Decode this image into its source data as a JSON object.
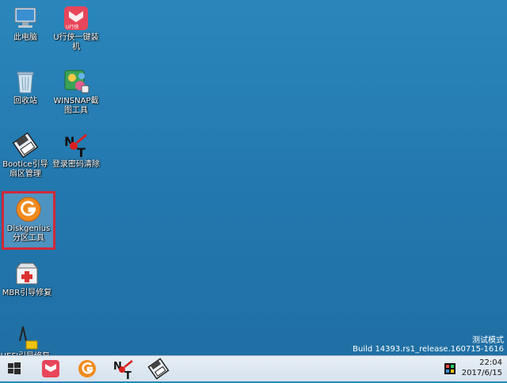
{
  "desktop": {
    "icons": [
      {
        "label": "此电脑",
        "icon": "computer-icon"
      },
      {
        "label": "U行侠一键装机",
        "icon": "u-xingxia-icon",
        "badge": "U行侠"
      },
      {
        "label": "回收站",
        "icon": "recycle-bin-icon"
      },
      {
        "label": "WINSNAP截图工具",
        "icon": "winsnap-icon"
      },
      {
        "label": "Bootice引导扇区管理",
        "icon": "bootice-icon"
      },
      {
        "label": "登录密码清除",
        "icon": "password-reset-icon"
      },
      {
        "label": "Diskgenius分区工具",
        "icon": "diskgenius-icon"
      },
      {
        "label": "MBR引导修复",
        "icon": "mbr-repair-icon"
      },
      {
        "label": "UEFI引导修复",
        "icon": "uefi-repair-icon"
      }
    ],
    "selected_icon": "Diskgenius分区工具"
  },
  "watermark": {
    "mode": "测试模式",
    "build": "Build 14393.rs1_release.160715-1616"
  },
  "taskbar": {
    "start": "windows-start-icon",
    "pinned": [
      {
        "name": "U行侠",
        "icon": "u-xingxia-icon"
      },
      {
        "name": "Diskgenius",
        "icon": "diskgenius-icon"
      },
      {
        "name": "登录密码清除",
        "icon": "password-reset-icon"
      },
      {
        "name": "Bootice",
        "icon": "bootice-icon"
      }
    ],
    "clock": {
      "time": "22:04",
      "date": "2017/6/15"
    }
  },
  "colors": {
    "desktop_bg": "#2279af",
    "selection_border": "#d1283a",
    "taskbar_bg": "#dfe8f0"
  }
}
